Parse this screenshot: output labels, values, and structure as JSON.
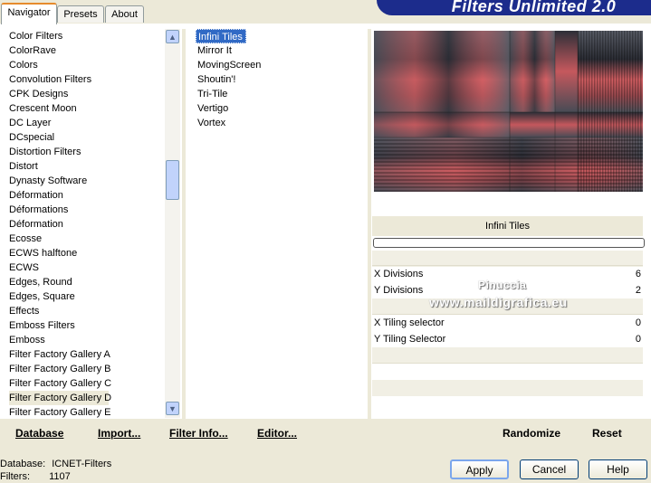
{
  "tabs": [
    {
      "label": "Navigator",
      "active": true
    },
    {
      "label": "Presets",
      "active": false
    },
    {
      "label": "About",
      "active": false
    }
  ],
  "app_title": "Filters Unlimited 2.0",
  "categories": [
    "Color Filters",
    "ColorRave",
    "Colors",
    "Convolution Filters",
    "CPK Designs",
    "Crescent Moon",
    "DC Layer",
    "DCspecial",
    "Distortion Filters",
    "Distort",
    "Dynasty Software",
    "Déformation",
    "Déformations",
    "Déformation",
    "Ecosse",
    "ECWS halftone",
    "ECWS",
    "Edges, Round",
    "Edges, Square",
    "Effects",
    "Emboss Filters",
    "Emboss",
    "Filter Factory Gallery A",
    "Filter Factory Gallery B",
    "Filter Factory Gallery C",
    "Filter Factory Gallery D",
    "Filter Factory Gallery E"
  ],
  "selected_category": "Filter Factory Gallery D",
  "filters": [
    "Infini Tiles",
    "Mirror It",
    "MovingScreen",
    "Shoutin'!",
    "Tri-Tile",
    "Vertigo",
    "Vortex"
  ],
  "selected_filter": "Infini Tiles",
  "filter_name": "Infini Tiles",
  "params": [
    {
      "label": "X Divisions",
      "value": "6"
    },
    {
      "label": "Y Divisions",
      "value": "2"
    },
    {
      "label": "X Tiling selector",
      "value": "0"
    },
    {
      "label": "Y Tiling Selector",
      "value": "0"
    }
  ],
  "watermark": {
    "line1": "Pinuccia",
    "line2": "www.maildigrafica.eu"
  },
  "toolbar": {
    "database": "Database",
    "import": "Import...",
    "filter_info": "Filter Info...",
    "editor": "Editor...",
    "randomize": "Randomize",
    "reset": "Reset"
  },
  "status": {
    "database_label": "Database:",
    "database_value": "ICNET-Filters",
    "filters_label": "Filters:",
    "filters_value": "1107"
  },
  "buttons": {
    "apply": "Apply",
    "cancel": "Cancel",
    "help": "Help"
  },
  "colors": {
    "accent": "#316ac5",
    "banner": "#1c2c8c",
    "tab_highlight": "#e68b2c"
  }
}
